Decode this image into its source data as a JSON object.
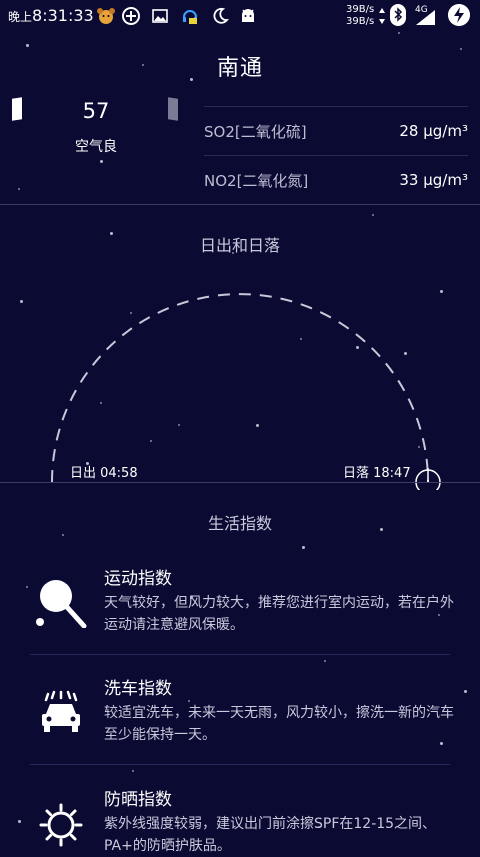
{
  "status_bar": {
    "time_prefix": "晚上",
    "time": "8:31:33",
    "net_up": "39B/s",
    "net_down": "39B/s",
    "network_type": "4G"
  },
  "city": "南通",
  "aqi": {
    "value": "57",
    "label": "空气良"
  },
  "pollutants": [
    {
      "name": "SO2[二氧化硫]",
      "value": "28 μg/m³"
    },
    {
      "name": "NO2[二氧化氮]",
      "value": "33 μg/m³"
    }
  ],
  "sun": {
    "title": "日出和日落",
    "sunrise": "日出 04:58",
    "sunset": "日落 18:47"
  },
  "life": {
    "title": "生活指数",
    "items": [
      {
        "title": "运动指数",
        "desc": "天气较好，但风力较大，推荐您进行室内运动，若在户外运动请注意避风保暖。",
        "icon": "sport-racket-icon"
      },
      {
        "title": "洗车指数",
        "desc": "较适宜洗车，未来一天无雨，风力较小，擦洗一新的汽车至少能保持一天。",
        "icon": "car-wash-icon"
      },
      {
        "title": "防晒指数",
        "desc": "紫外线强度较弱，建议出门前涂擦SPF在12-15之间、PA+的防晒护肤品。",
        "icon": "sun-icon"
      }
    ]
  }
}
